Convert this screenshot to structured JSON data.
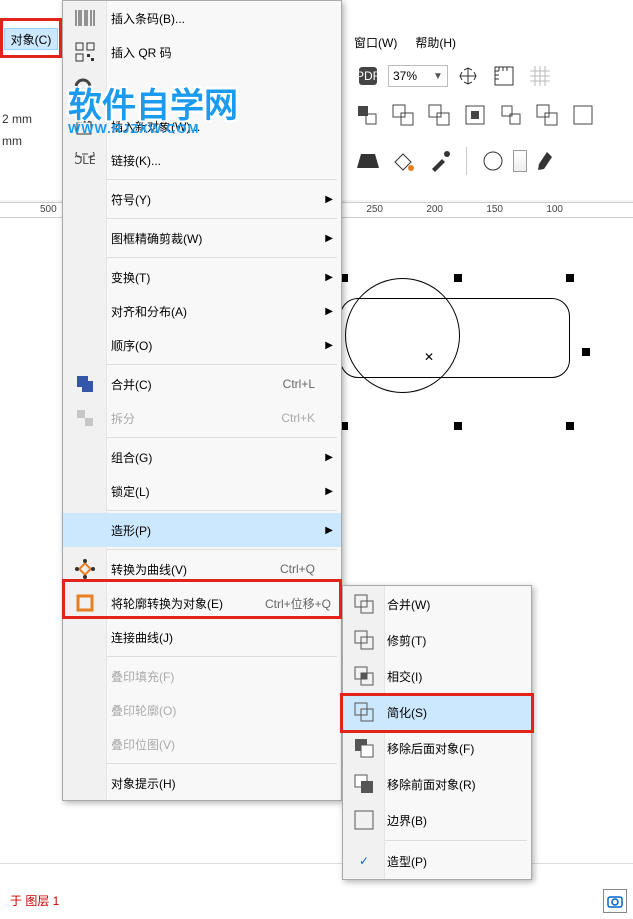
{
  "menubar": {
    "object": "对象(C)",
    "window": "窗口(W)",
    "help": "帮助(H)"
  },
  "zoom": {
    "value": "37%"
  },
  "units": {
    "mm_a": "2 mm",
    "mm_b": "mm"
  },
  "ruler": {
    "t500": "500",
    "t250": "250",
    "t200": "200",
    "t150": "150",
    "t100": "100"
  },
  "watermark": {
    "title": "软件自学网",
    "url": "WWW.RJZXW.COM"
  },
  "menu1": {
    "insert_barcode": "插入条码(B)...",
    "insert_qr": "插入 QR 码",
    "insert_new_obj": "插入新对象(W)...",
    "links": "链接(K)...",
    "symbols": "符号(Y)",
    "powerclip": "图框精确剪裁(W)",
    "transform": "变换(T)",
    "align": "对齐和分布(A)",
    "order": "顺序(O)",
    "combine": "合并(C)",
    "combine_sc": "Ctrl+L",
    "break": "拆分",
    "break_sc": "Ctrl+K",
    "group": "组合(G)",
    "lock": "锁定(L)",
    "shaping": "造形(P)",
    "to_curve": "转换为曲线(V)",
    "to_curve_sc": "Ctrl+Q",
    "outline_obj": "将轮廓转换为对象(E)",
    "outline_obj_sc": "Ctrl+位移+Q",
    "join_curves": "连接曲线(J)",
    "overprint_fill": "叠印填充(F)",
    "overprint_outline": "叠印轮廓(O)",
    "overprint_bitmap": "叠印位图(V)",
    "obj_hint": "对象提示(H)"
  },
  "menu2": {
    "weld": "合并(W)",
    "trim": "修剪(T)",
    "intersect": "相交(I)",
    "simplify": "简化(S)",
    "front_minus": "移除后面对象(F)",
    "back_minus": "移除前面对象(R)",
    "boundary": "边界(B)",
    "shaping": "造型(P)"
  },
  "status": {
    "layer": "于 图层 1"
  }
}
